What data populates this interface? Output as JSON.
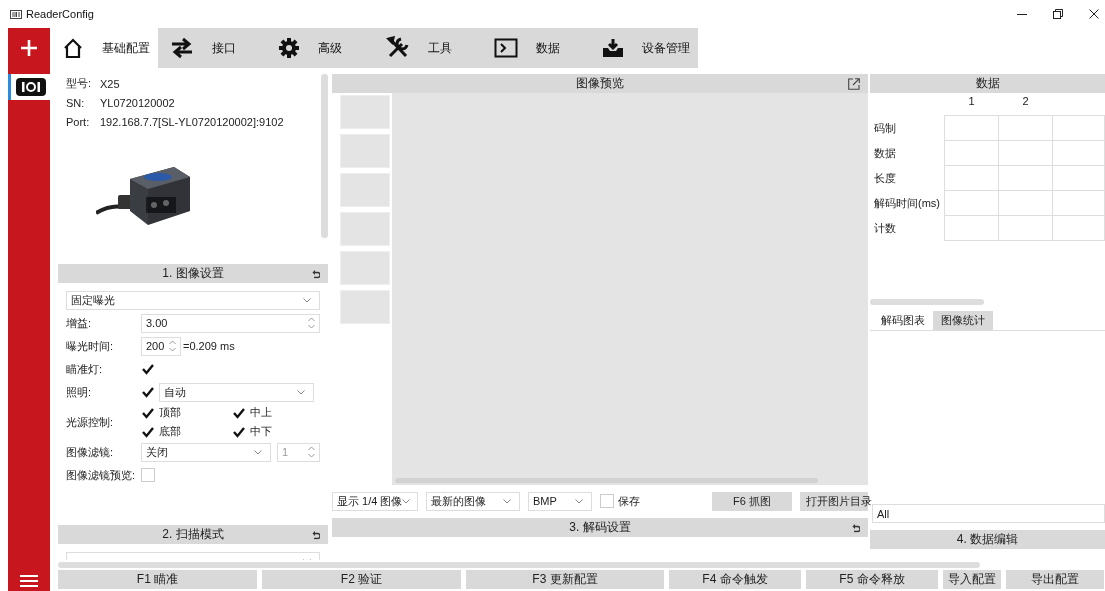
{
  "window": {
    "title": "ReaderConfig"
  },
  "tabs": [
    {
      "label": "基础配置",
      "selected": true
    },
    {
      "label": "接口",
      "selected": false
    },
    {
      "label": "高级",
      "selected": false
    },
    {
      "label": "工具",
      "selected": false
    },
    {
      "label": "数据",
      "selected": false
    },
    {
      "label": "设备管理",
      "selected": false
    }
  ],
  "rail": {
    "items": [
      {
        "selected": true
      }
    ]
  },
  "device": {
    "fields": [
      {
        "label": "型号:",
        "value": "X25"
      },
      {
        "label": "SN:",
        "value": "YL0720120002"
      },
      {
        "label": "Port:",
        "value": "192.168.7.7[SL-YL0720120002]:9102"
      }
    ]
  },
  "image_settings": {
    "title": "1. 图像设置",
    "mode": "固定曝光",
    "rows": [
      {
        "kind": "spin",
        "label": "增益:",
        "value": "3.00"
      },
      {
        "kind": "exposure",
        "label": "曝光时间:",
        "value": "200",
        "reading": "=0.209 ms"
      },
      {
        "kind": "check",
        "label": "瞄准灯:",
        "checked": true
      },
      {
        "kind": "check_select",
        "label": "照明:",
        "checked": true,
        "value": "自动"
      },
      {
        "kind": "check_grid",
        "label": "光源控制:",
        "options": [
          {
            "label": "顶部",
            "checked": true
          },
          {
            "label": "中上",
            "checked": true
          },
          {
            "label": "底部",
            "checked": true
          },
          {
            "label": "中下",
            "checked": true
          }
        ]
      },
      {
        "kind": "select_spin",
        "label": "图像滤镜:",
        "value": "关闭",
        "number": "1"
      },
      {
        "kind": "check",
        "label": "图像滤镜预览:",
        "checked": false
      }
    ]
  },
  "scan_mode": {
    "title": "2. 扫描模式"
  },
  "preview": {
    "title": "图像预览"
  },
  "toolbar": {
    "selects": [
      "显示 1/4 图像",
      "最新的图像",
      "BMP"
    ],
    "save": {
      "label": "保存",
      "checked": false
    },
    "buttons": [
      "F6 抓图",
      "打开图片目录"
    ]
  },
  "decode_settings": {
    "title": "3. 解码设置"
  },
  "data": {
    "title": "数据",
    "columns": [
      "1",
      "2"
    ],
    "rows": [
      "码制",
      "数据",
      "长度",
      "解码时间(ms)",
      "计数"
    ],
    "tabs": [
      {
        "label": "解码图表",
        "selected": true
      },
      {
        "label": "图像统计",
        "selected": false
      }
    ],
    "filter": "All"
  },
  "data_edit": {
    "title": "4. 数据编辑"
  },
  "buttons": [
    "F1 瞄准",
    "F2 验证",
    "F3 更新配置",
    "F4 命令触发",
    "F5 命令释放",
    "导入配置",
    "导出配置"
  ]
}
